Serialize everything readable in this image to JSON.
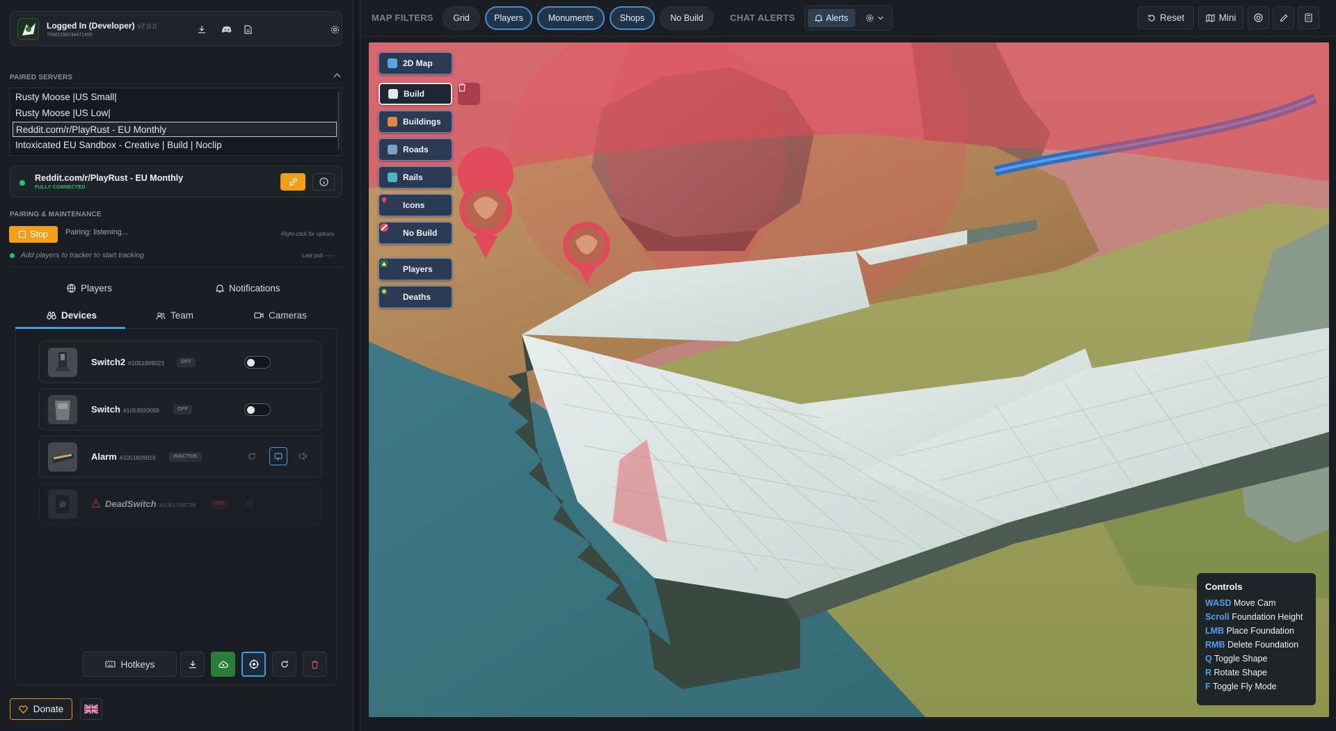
{
  "account": {
    "title": "Logged In (Developer)",
    "version": "v7.0.0",
    "steam_id": "76561198234471456",
    "actions": [
      "download-icon",
      "discord-icon",
      "document-icon",
      "gear-icon"
    ]
  },
  "servers": {
    "section_label": "PAIRED SERVERS",
    "items": [
      {
        "name": "Rusty Moose |US Small|",
        "selected": false
      },
      {
        "name": "Rusty Moose |US Low|",
        "selected": false
      },
      {
        "name": "Reddit.com/r/PlayRust - EU Monthly",
        "selected": true
      },
      {
        "name": "Intoxicated EU Sandbox - Creative | Build | Noclip",
        "selected": false
      }
    ]
  },
  "connection": {
    "name": "Reddit.com/r/PlayRust - EU Monthly",
    "status": "FULLY CONNECTED",
    "status_color": "#27c46b"
  },
  "pairing": {
    "section_label": "PAIRING & MAINTENANCE",
    "stop_label": "Stop",
    "status": "Pairing: listening...",
    "hint": "Right-click for options",
    "tracker_text": "Add players to tracker to start tracking",
    "last_poll": "Last poll: --:--"
  },
  "tabs": {
    "top": [
      {
        "label": "Players",
        "icon": "globe-icon"
      },
      {
        "label": "Notifications",
        "icon": "bell-icon"
      }
    ],
    "sub": [
      {
        "label": "Devices",
        "icon": "binoculars-icon",
        "active": true
      },
      {
        "label": "Team",
        "icon": "team-icon",
        "active": false
      },
      {
        "label": "Cameras",
        "icon": "camera-icon",
        "active": false
      }
    ]
  },
  "devices": [
    {
      "name": "Switch2",
      "id": "#1051889023",
      "status": "OFF",
      "on": false
    },
    {
      "name": "Switch",
      "id": "#1053920059",
      "status": "OFF",
      "on": false
    },
    {
      "name": "Alarm",
      "id": "#1051826916",
      "status": "INACTIVE"
    },
    {
      "name": "DeadSwitch",
      "id": "#1051769738",
      "status": "OFF"
    }
  ],
  "bottom_bar": {
    "hotkeys_label": "Hotkeys"
  },
  "footer": {
    "donate_label": "Donate"
  },
  "topbar": {
    "map_filters_label": "MAP FILTERS",
    "filters": [
      {
        "label": "Grid",
        "on": false
      },
      {
        "label": "Players",
        "on": true
      },
      {
        "label": "Monuments",
        "on": true
      },
      {
        "label": "Shops",
        "on": true
      },
      {
        "label": "No Build",
        "on": false
      }
    ],
    "chat_alerts_label": "CHAT ALERTS",
    "alerts_label": "Alerts",
    "reset_label": "Reset",
    "mini_label": "Mini"
  },
  "layers": [
    {
      "label": "2D Map",
      "icon": "map-icon",
      "active": false
    },
    {
      "label": "Build",
      "icon": "build-icon",
      "active": true
    },
    {
      "label": "Buildings",
      "icon": "buildings-icon",
      "active": false
    },
    {
      "label": "Roads",
      "icon": "roads-icon",
      "active": false
    },
    {
      "label": "Rails",
      "icon": "rails-icon",
      "active": false
    },
    {
      "label": "Icons",
      "icon": "pin-icon",
      "active": false
    },
    {
      "label": "No Build",
      "icon": "no-build-icon",
      "active": false
    },
    {
      "label": "Players",
      "icon": "players-icon",
      "active": false
    },
    {
      "label": "Deaths",
      "icon": "deaths-icon",
      "active": false
    }
  ],
  "controls": {
    "title": "Controls",
    "rows": [
      {
        "key": "WASD",
        "action": "Move Cam"
      },
      {
        "key": "Scroll",
        "action": "Foundation Height"
      },
      {
        "key": "LMB",
        "action": "Place Foundation"
      },
      {
        "key": "RMB",
        "action": "Delete Foundation"
      },
      {
        "key": "Q",
        "action": "Toggle Shape"
      },
      {
        "key": "R",
        "action": "Rotate Shape"
      },
      {
        "key": "F",
        "action": "Toggle Fly Mode"
      }
    ]
  },
  "colors": {
    "accent": "#3da0e6",
    "warning": "#f59e1c",
    "success": "#27c46b",
    "no_build_zone": "#e24a5c"
  }
}
